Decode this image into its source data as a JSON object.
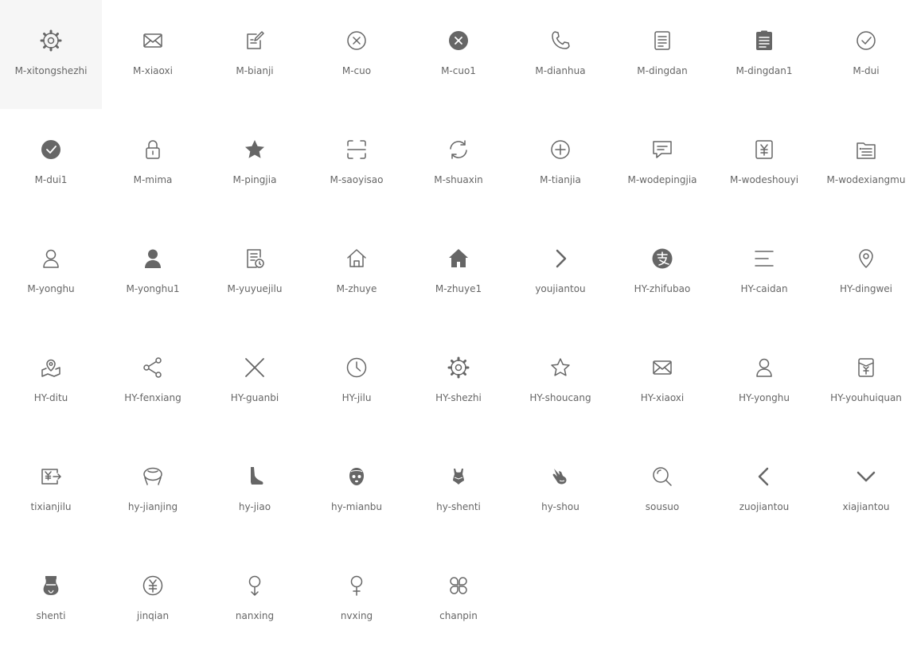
{
  "colors": {
    "icon": "#666666",
    "label": "#666666",
    "background": "#ffffff"
  },
  "icons": [
    {
      "name": "M-xitongshezhi",
      "icon": "gear-icon"
    },
    {
      "name": "M-xiaoxi",
      "icon": "envelope-icon"
    },
    {
      "name": "M-bianji",
      "icon": "edit-icon"
    },
    {
      "name": "M-cuo",
      "icon": "close-circle-icon"
    },
    {
      "name": "M-cuo1",
      "icon": "close-circle-filled-icon"
    },
    {
      "name": "M-dianhua",
      "icon": "phone-icon"
    },
    {
      "name": "M-dingdan",
      "icon": "order-icon"
    },
    {
      "name": "M-dingdan1",
      "icon": "order-filled-icon"
    },
    {
      "name": "M-dui",
      "icon": "check-circle-icon"
    },
    {
      "name": "M-dui1",
      "icon": "check-circle-filled-icon"
    },
    {
      "name": "M-mima",
      "icon": "lock-icon"
    },
    {
      "name": "M-pingjia",
      "icon": "star-filled-icon"
    },
    {
      "name": "M-saoyisao",
      "icon": "scan-icon"
    },
    {
      "name": "M-shuaxin",
      "icon": "refresh-icon"
    },
    {
      "name": "M-tianjia",
      "icon": "add-circle-icon"
    },
    {
      "name": "M-wodepingjia",
      "icon": "comment-icon"
    },
    {
      "name": "M-wodeshouyi",
      "icon": "earnings-icon"
    },
    {
      "name": "M-wodexiangmu",
      "icon": "project-list-icon"
    },
    {
      "name": "M-yonghu",
      "icon": "user-icon"
    },
    {
      "name": "M-yonghu1",
      "icon": "user-filled-icon"
    },
    {
      "name": "M-yuyuejilu",
      "icon": "appointment-record-icon"
    },
    {
      "name": "M-zhuye",
      "icon": "home-icon"
    },
    {
      "name": "M-zhuye1",
      "icon": "home-filled-icon"
    },
    {
      "name": "youjiantou",
      "icon": "chevron-right-icon"
    },
    {
      "name": "HY-zhifubao",
      "icon": "alipay-icon"
    },
    {
      "name": "HY-caidan",
      "icon": "menu-icon"
    },
    {
      "name": "HY-dingwei",
      "icon": "location-pin-icon"
    },
    {
      "name": "HY-ditu",
      "icon": "map-icon"
    },
    {
      "name": "HY-fenxiang",
      "icon": "share-icon"
    },
    {
      "name": "HY-guanbi",
      "icon": "close-icon"
    },
    {
      "name": "HY-jilu",
      "icon": "clock-icon"
    },
    {
      "name": "HY-shezhi",
      "icon": "gear-icon"
    },
    {
      "name": "HY-shoucang",
      "icon": "star-icon"
    },
    {
      "name": "HY-xiaoxi",
      "icon": "envelope-icon"
    },
    {
      "name": "HY-yonghu",
      "icon": "user-icon"
    },
    {
      "name": "HY-youhuiquan",
      "icon": "coupon-icon"
    },
    {
      "name": "tixianjilu",
      "icon": "withdraw-record-icon"
    },
    {
      "name": "hy-jianjing",
      "icon": "shoulder-neck-icon"
    },
    {
      "name": "hy-jiao",
      "icon": "foot-icon"
    },
    {
      "name": "hy-mianbu",
      "icon": "face-mask-icon"
    },
    {
      "name": "hy-shenti",
      "icon": "swimsuit-icon"
    },
    {
      "name": "hy-shou",
      "icon": "hand-icon"
    },
    {
      "name": "sousuo",
      "icon": "search-icon"
    },
    {
      "name": "zuojiantou",
      "icon": "chevron-left-icon"
    },
    {
      "name": "xiajiantou",
      "icon": "chevron-down-icon"
    },
    {
      "name": "shenti",
      "icon": "body-icon"
    },
    {
      "name": "jinqian",
      "icon": "money-icon"
    },
    {
      "name": "nanxing",
      "icon": "male-icon"
    },
    {
      "name": "nvxing",
      "icon": "female-icon"
    },
    {
      "name": "chanpin",
      "icon": "product-icon"
    }
  ]
}
